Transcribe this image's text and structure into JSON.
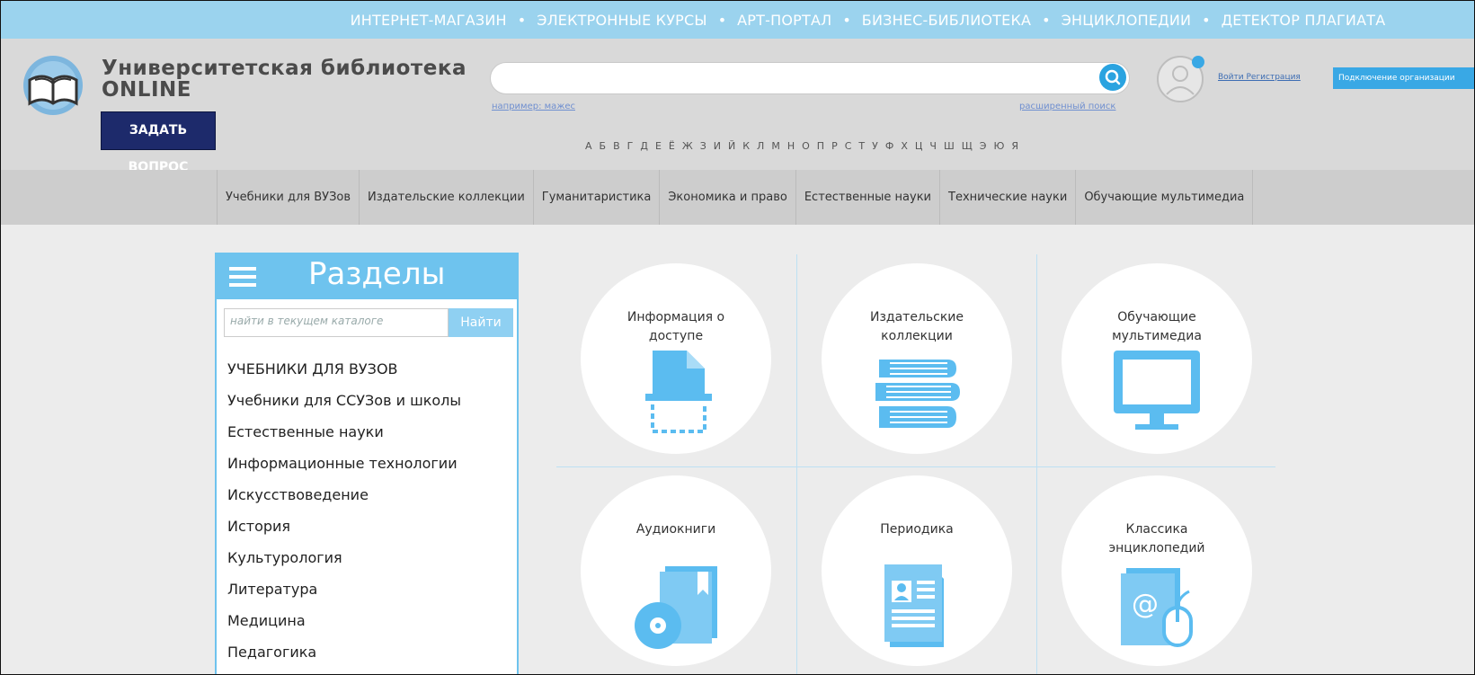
{
  "topbar": {
    "items": [
      "ИНТЕРНЕТ-МАГАЗИН",
      "ЭЛЕКТРОННЫЕ КУРСЫ",
      "АРТ-ПОРТАЛ",
      "БИЗНЕС-БИБЛИОТЕКА",
      "ЭНЦИКЛОПЕДИИ",
      "ДЕТЕКТОР ПЛАГИАТА"
    ],
    "separator": "•"
  },
  "header": {
    "logo_line1": "Университетская библиотека",
    "logo_line2": "ONLINE",
    "ask_button": "ЗАДАТЬ ВОПРОС",
    "search_value": "",
    "search_hint": "например: мажес",
    "advanced_search": "расширенный поиск",
    "login_link": "Войти Регистрация",
    "connect_button": "Подключение организации",
    "alphabet": [
      "А",
      "Б",
      "В",
      "Г",
      "Д",
      "Е",
      "Ё",
      "Ж",
      "З",
      "И",
      "Й",
      "К",
      "Л",
      "М",
      "Н",
      "О",
      "П",
      "Р",
      "С",
      "Т",
      "У",
      "Ф",
      "Х",
      "Ц",
      "Ч",
      "Ш",
      "Щ",
      "Э",
      "Ю",
      "Я"
    ]
  },
  "categories": [
    "Учебники для ВУЗов",
    "Издательские коллекции",
    "Гуманитаристика",
    "Экономика и право",
    "Естественные науки",
    "Технические науки",
    "Обучающие мультимедиа"
  ],
  "sections": {
    "title": "Разделы",
    "search_placeholder": "найти в текущем каталоге",
    "find_button": "Найти",
    "items": [
      "УЧЕБНИКИ ДЛЯ ВУЗОВ",
      "Учебники для ССУЗов и школы",
      "Естественные науки",
      "Информационные технологии",
      "Искусствоведение",
      "История",
      "Культурология",
      "Литература",
      "Медицина",
      "Педагогика"
    ]
  },
  "tiles": [
    {
      "label_1": "Информация о",
      "label_2": "доступе",
      "icon": "document-scan-icon"
    },
    {
      "label_1": "Издательские",
      "label_2": "коллекции",
      "icon": "books-stack-icon"
    },
    {
      "label_1": "Обучающие",
      "label_2": "мультимедиа",
      "icon": "monitor-icon"
    },
    {
      "label_1": "Аудиокниги",
      "label_2": "",
      "icon": "audiobook-disc-icon"
    },
    {
      "label_1": "Периодика",
      "label_2": "",
      "icon": "periodical-icon"
    },
    {
      "label_1": "Классика",
      "label_2": "энциклопедий",
      "icon": "encyclopedia-mouse-icon"
    }
  ],
  "colors": {
    "accent": "#39a8e5",
    "icon_blue": "#5bbcf0",
    "topbar": "#9bd3ee",
    "ask_button": "#1d2a6b"
  }
}
